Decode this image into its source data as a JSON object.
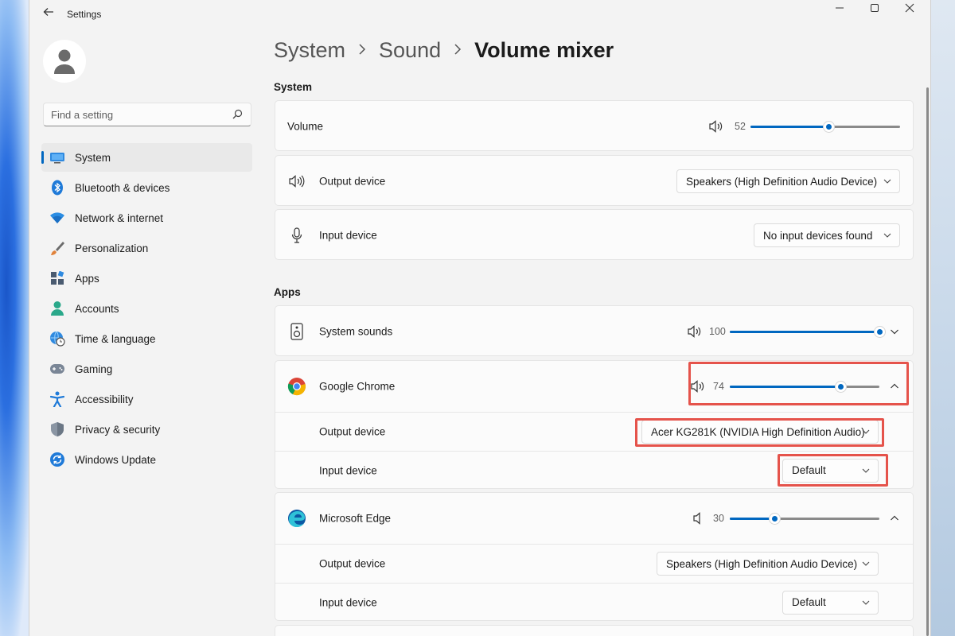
{
  "window": {
    "app_title": "Settings"
  },
  "sidebar": {
    "search_placeholder": "Find a setting",
    "items": [
      {
        "label": "System",
        "active": true
      },
      {
        "label": "Bluetooth & devices"
      },
      {
        "label": "Network & internet"
      },
      {
        "label": "Personalization"
      },
      {
        "label": "Apps"
      },
      {
        "label": "Accounts"
      },
      {
        "label": "Time & language"
      },
      {
        "label": "Gaming"
      },
      {
        "label": "Accessibility"
      },
      {
        "label": "Privacy & security"
      },
      {
        "label": "Windows Update"
      }
    ]
  },
  "breadcrumb": {
    "items": [
      "System",
      "Sound",
      "Volume mixer"
    ]
  },
  "system_section": {
    "title": "System",
    "volume": {
      "label": "Volume",
      "value": 52
    },
    "output_device": {
      "label": "Output device",
      "selected": "Speakers (High Definition Audio Device)"
    },
    "input_device": {
      "label": "Input device",
      "selected": "No input devices found"
    }
  },
  "apps_section": {
    "title": "Apps",
    "apps": [
      {
        "name": "System sounds",
        "volume": 100,
        "expanded": false
      },
      {
        "name": "Google Chrome",
        "volume": 74,
        "expanded": true,
        "output_label": "Output device",
        "output_selected": "Acer KG281K (NVIDIA High Definition Audio)",
        "input_label": "Input device",
        "input_selected": "Default"
      },
      {
        "name": "Microsoft Edge",
        "volume": 30,
        "expanded": true,
        "output_label": "Output device",
        "output_selected": "Speakers (High Definition Audio Device)",
        "input_label": "Input device",
        "input_selected": "Default"
      }
    ]
  },
  "colors": {
    "accent": "#0067c0",
    "highlight": "#e5534b"
  }
}
